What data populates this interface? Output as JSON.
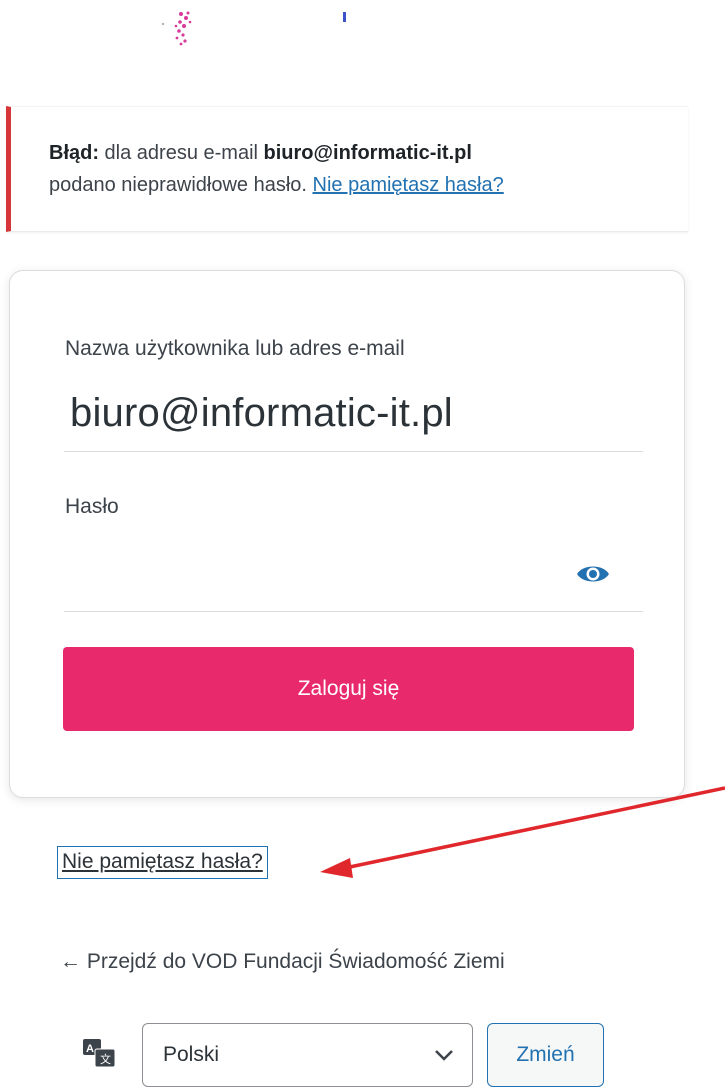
{
  "notice": {
    "prefix": "Błąd:",
    "text1": " dla adresu e-mail ",
    "email": "biuro@informatic-it.pl",
    "text2": "podano nieprawidłowe hasło. ",
    "link": "Nie pamiętasz hasła?"
  },
  "form": {
    "user_label": "Nazwa użytkownika lub adres e-mail",
    "user_value": "biuro@informatic-it.pl",
    "password_label": "Hasło",
    "submit_label": "Zaloguj się"
  },
  "links": {
    "lost_password": "Nie pamiętasz hasła?",
    "back": "← Przejdź do VOD Fundacji Świadomość Ziemi"
  },
  "language": {
    "selected": "Polski",
    "change_label": "Zmień"
  },
  "colors": {
    "error": "#d63638",
    "accent": "#e82a6c",
    "link": "#2271b1",
    "annotation_arrow": "#e0272b"
  }
}
